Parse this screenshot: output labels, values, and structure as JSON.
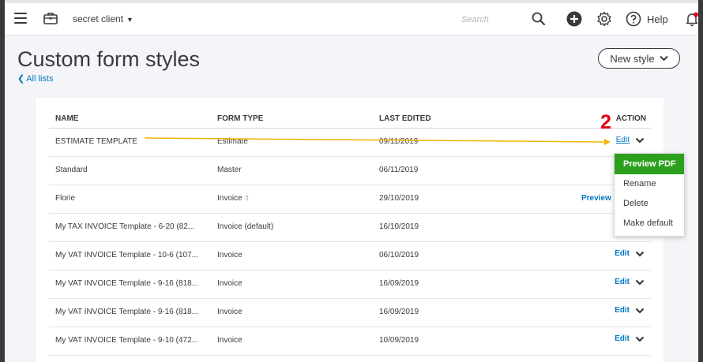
{
  "header": {
    "company_name": "secret client",
    "search_placeholder": "Search",
    "help_label": "Help",
    "icons": [
      "hamburger-icon",
      "briefcase-icon",
      "search-icon",
      "plus-icon",
      "gear-icon",
      "help-icon",
      "bell-icon"
    ]
  },
  "page": {
    "title": "Custom form styles",
    "back_link": "All lists",
    "new_style_label": "New style"
  },
  "table": {
    "columns": [
      "NAME",
      "FORM TYPE",
      "LAST EDITED",
      "ACTION"
    ],
    "rows": [
      {
        "name": "ESTIMATE TEMPLATE",
        "type": "Estimate",
        "date": "09/11/2019",
        "action": "Edit"
      },
      {
        "name": "Standard",
        "type": "Master",
        "date": "06/11/2019",
        "action": ""
      },
      {
        "name": "Florie",
        "type": "Invoice",
        "date": "29/10/2019",
        "action": "Preview"
      },
      {
        "name": "My TAX INVOICE Template - 6-20 (82...",
        "type": "Invoice (default)",
        "date": "16/10/2019",
        "action": ""
      },
      {
        "name": "My VAT INVOICE Template - 10-6 (107...",
        "type": "Invoice",
        "date": "06/10/2019",
        "action": "Edit"
      },
      {
        "name": "My VAT INVOICE Template - 9-16 (818...",
        "type": "Invoice",
        "date": "16/09/2019",
        "action": "Edit"
      },
      {
        "name": "My VAT INVOICE Template - 9-16 (818...",
        "type": "Invoice",
        "date": "16/09/2019",
        "action": "Edit"
      },
      {
        "name": "My VAT INVOICE Template - 9-10 (472...",
        "type": "Invoice",
        "date": "10/09/2019",
        "action": "Edit"
      }
    ]
  },
  "dropdown": {
    "items": [
      "Preview PDF",
      "Rename",
      "Delete",
      "Make default"
    ]
  },
  "annotation": {
    "number": "2"
  },
  "colors": {
    "link": "#0077c5",
    "green": "#2ca01c",
    "annotation_red": "#e3000f",
    "annotation_line": "#f5b400"
  }
}
